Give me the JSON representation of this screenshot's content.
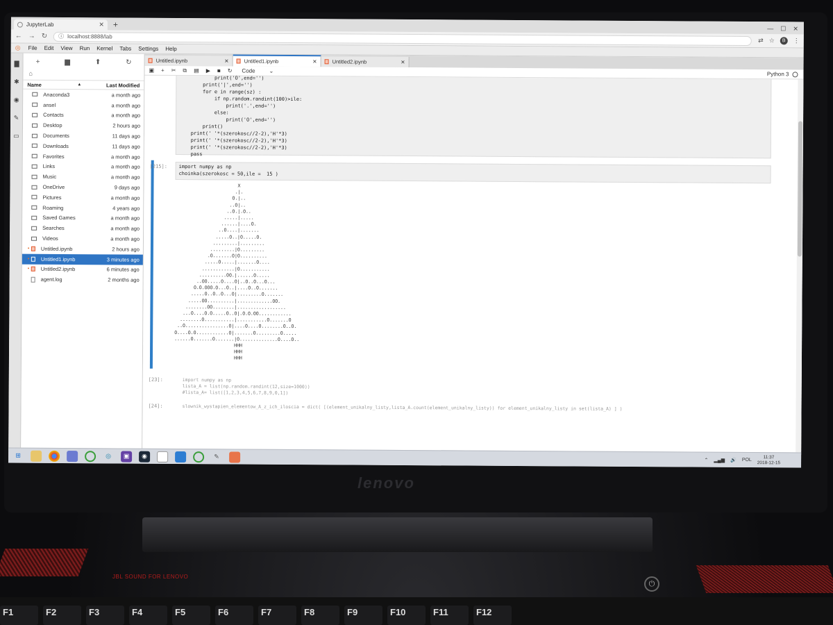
{
  "browser": {
    "tab_title": "JupyterLab",
    "new_tab": "+",
    "min": "—",
    "max": "☐",
    "close": "✕",
    "url": "localhost:8888/lab",
    "avatar": "B"
  },
  "menu": [
    "File",
    "Edit",
    "View",
    "Run",
    "Kernel",
    "Tabs",
    "Settings",
    "Help"
  ],
  "file_browser": {
    "col_name": "Name",
    "col_modified": "Last Modified",
    "files": [
      {
        "name": "Anaconda3",
        "modified": "a month ago",
        "kind": "folder"
      },
      {
        "name": "ansel",
        "modified": "a month ago",
        "kind": "folder"
      },
      {
        "name": "Contacts",
        "modified": "a month ago",
        "kind": "folder"
      },
      {
        "name": "Desktop",
        "modified": "2 hours ago",
        "kind": "folder"
      },
      {
        "name": "Documents",
        "modified": "11 days ago",
        "kind": "folder"
      },
      {
        "name": "Downloads",
        "modified": "11 days ago",
        "kind": "folder"
      },
      {
        "name": "Favorites",
        "modified": "a month ago",
        "kind": "folder"
      },
      {
        "name": "Links",
        "modified": "a month ago",
        "kind": "folder"
      },
      {
        "name": "Music",
        "modified": "a month ago",
        "kind": "folder"
      },
      {
        "name": "OneDrive",
        "modified": "9 days ago",
        "kind": "folder"
      },
      {
        "name": "Pictures",
        "modified": "a month ago",
        "kind": "folder"
      },
      {
        "name": "Roaming",
        "modified": "4 years ago",
        "kind": "folder"
      },
      {
        "name": "Saved Games",
        "modified": "a month ago",
        "kind": "folder"
      },
      {
        "name": "Searches",
        "modified": "a month ago",
        "kind": "folder"
      },
      {
        "name": "Videos",
        "modified": "a month ago",
        "kind": "folder"
      },
      {
        "name": "Untitled.ipynb",
        "modified": "2 hours ago",
        "kind": "notebook"
      },
      {
        "name": "Untitled1.ipynb",
        "modified": "3 minutes ago",
        "kind": "notebook",
        "selected": true
      },
      {
        "name": "Untitled2.ipynb",
        "modified": "6 minutes ago",
        "kind": "notebook"
      },
      {
        "name": "agent.log",
        "modified": "2 months ago",
        "kind": "file"
      }
    ]
  },
  "doc_tabs": [
    "Untitled.ipynb",
    "Untitled1.ipynb",
    "Untitled2.ipynb"
  ],
  "toolbar": {
    "cell_type": "Code",
    "kernel": "Python 3"
  },
  "cells": {
    "top_code": "            print('O',end='')\n        print('|',end='')\n        for e in range(sz) :\n            if np.random.randint(100)>ile:\n                print('.',end='')\n            else:\n                print('O',end='')\n        print()\n    print(' '*(szerokosc//2-2),'H'*3)\n    print(' '*(szerokosc//2-2),'H'*3)\n    print(' '*(szerokosc//2-2),'H'*3)\n    pass",
    "prompt_215": "[215]:",
    "code_215": "import numpy as np\nchoinka(szerokosc = 50,ile =  15 )",
    "tree_output": "                       X\n                      .|.\n                     O.|..\n                    ..O|..\n                   ..O.|.O..\n                  .....|.....\n                 ......|....O.\n                ..O....|.......\n               .....O..|O.....O.\n              .........|.........\n             .........|O.........\n            .O.......O|O..........\n           .....O.....|.......O....\n          ............|O...........\n         ..........OO.|......O.....\n        ..OO.....O....O|..O..O...O...\n       O.O.OOO.O...O..|....O..O.......\n      .....O..O..O...O|.........O.......\n     .....OO..........|.............OO.\n    ........OO........|..................\n   ...O....O.O.....O..O|.O.O.OO............\n  ........O...........|...........O.......O\n ..O................O|....O....O........O..O.\nO....O.O............O|.......O.........O.....\n......O.......O.......|O..............O....O..\n                      HHH\n                      HHH\n                      HHH",
    "prompt_next": "[23]:",
    "code_next": "import numpy as np\nlista_A = list(np.random.randint(12,size=1000))\n#lista_A= list([1,2,3,4,5,6,7,8,9,0,1])",
    "prompt_last": "[24]:",
    "code_last": "slownik_wystapien_elementow_A_z_ich_iloscia = dict( [(element_unikalny_listy,lista_A.count(element_unikalny_listy)) for element_unikalny_listy in set(lista_A) ] )"
  },
  "taskbar": {
    "lang": "POL",
    "time": "11:37",
    "date": "2018-12-15"
  },
  "laptop": {
    "brand": "lenovo",
    "audio_badge": "JBL SOUND FOR LENOVO",
    "fkeys": [
      "F1",
      "F2",
      "F3",
      "F4",
      "F5",
      "F6",
      "F7",
      "F8",
      "F9",
      "F10",
      "F11",
      "F12"
    ]
  },
  "colors": {
    "accent": "#2f75c4",
    "jupyter_orange": "#e46e2e"
  }
}
